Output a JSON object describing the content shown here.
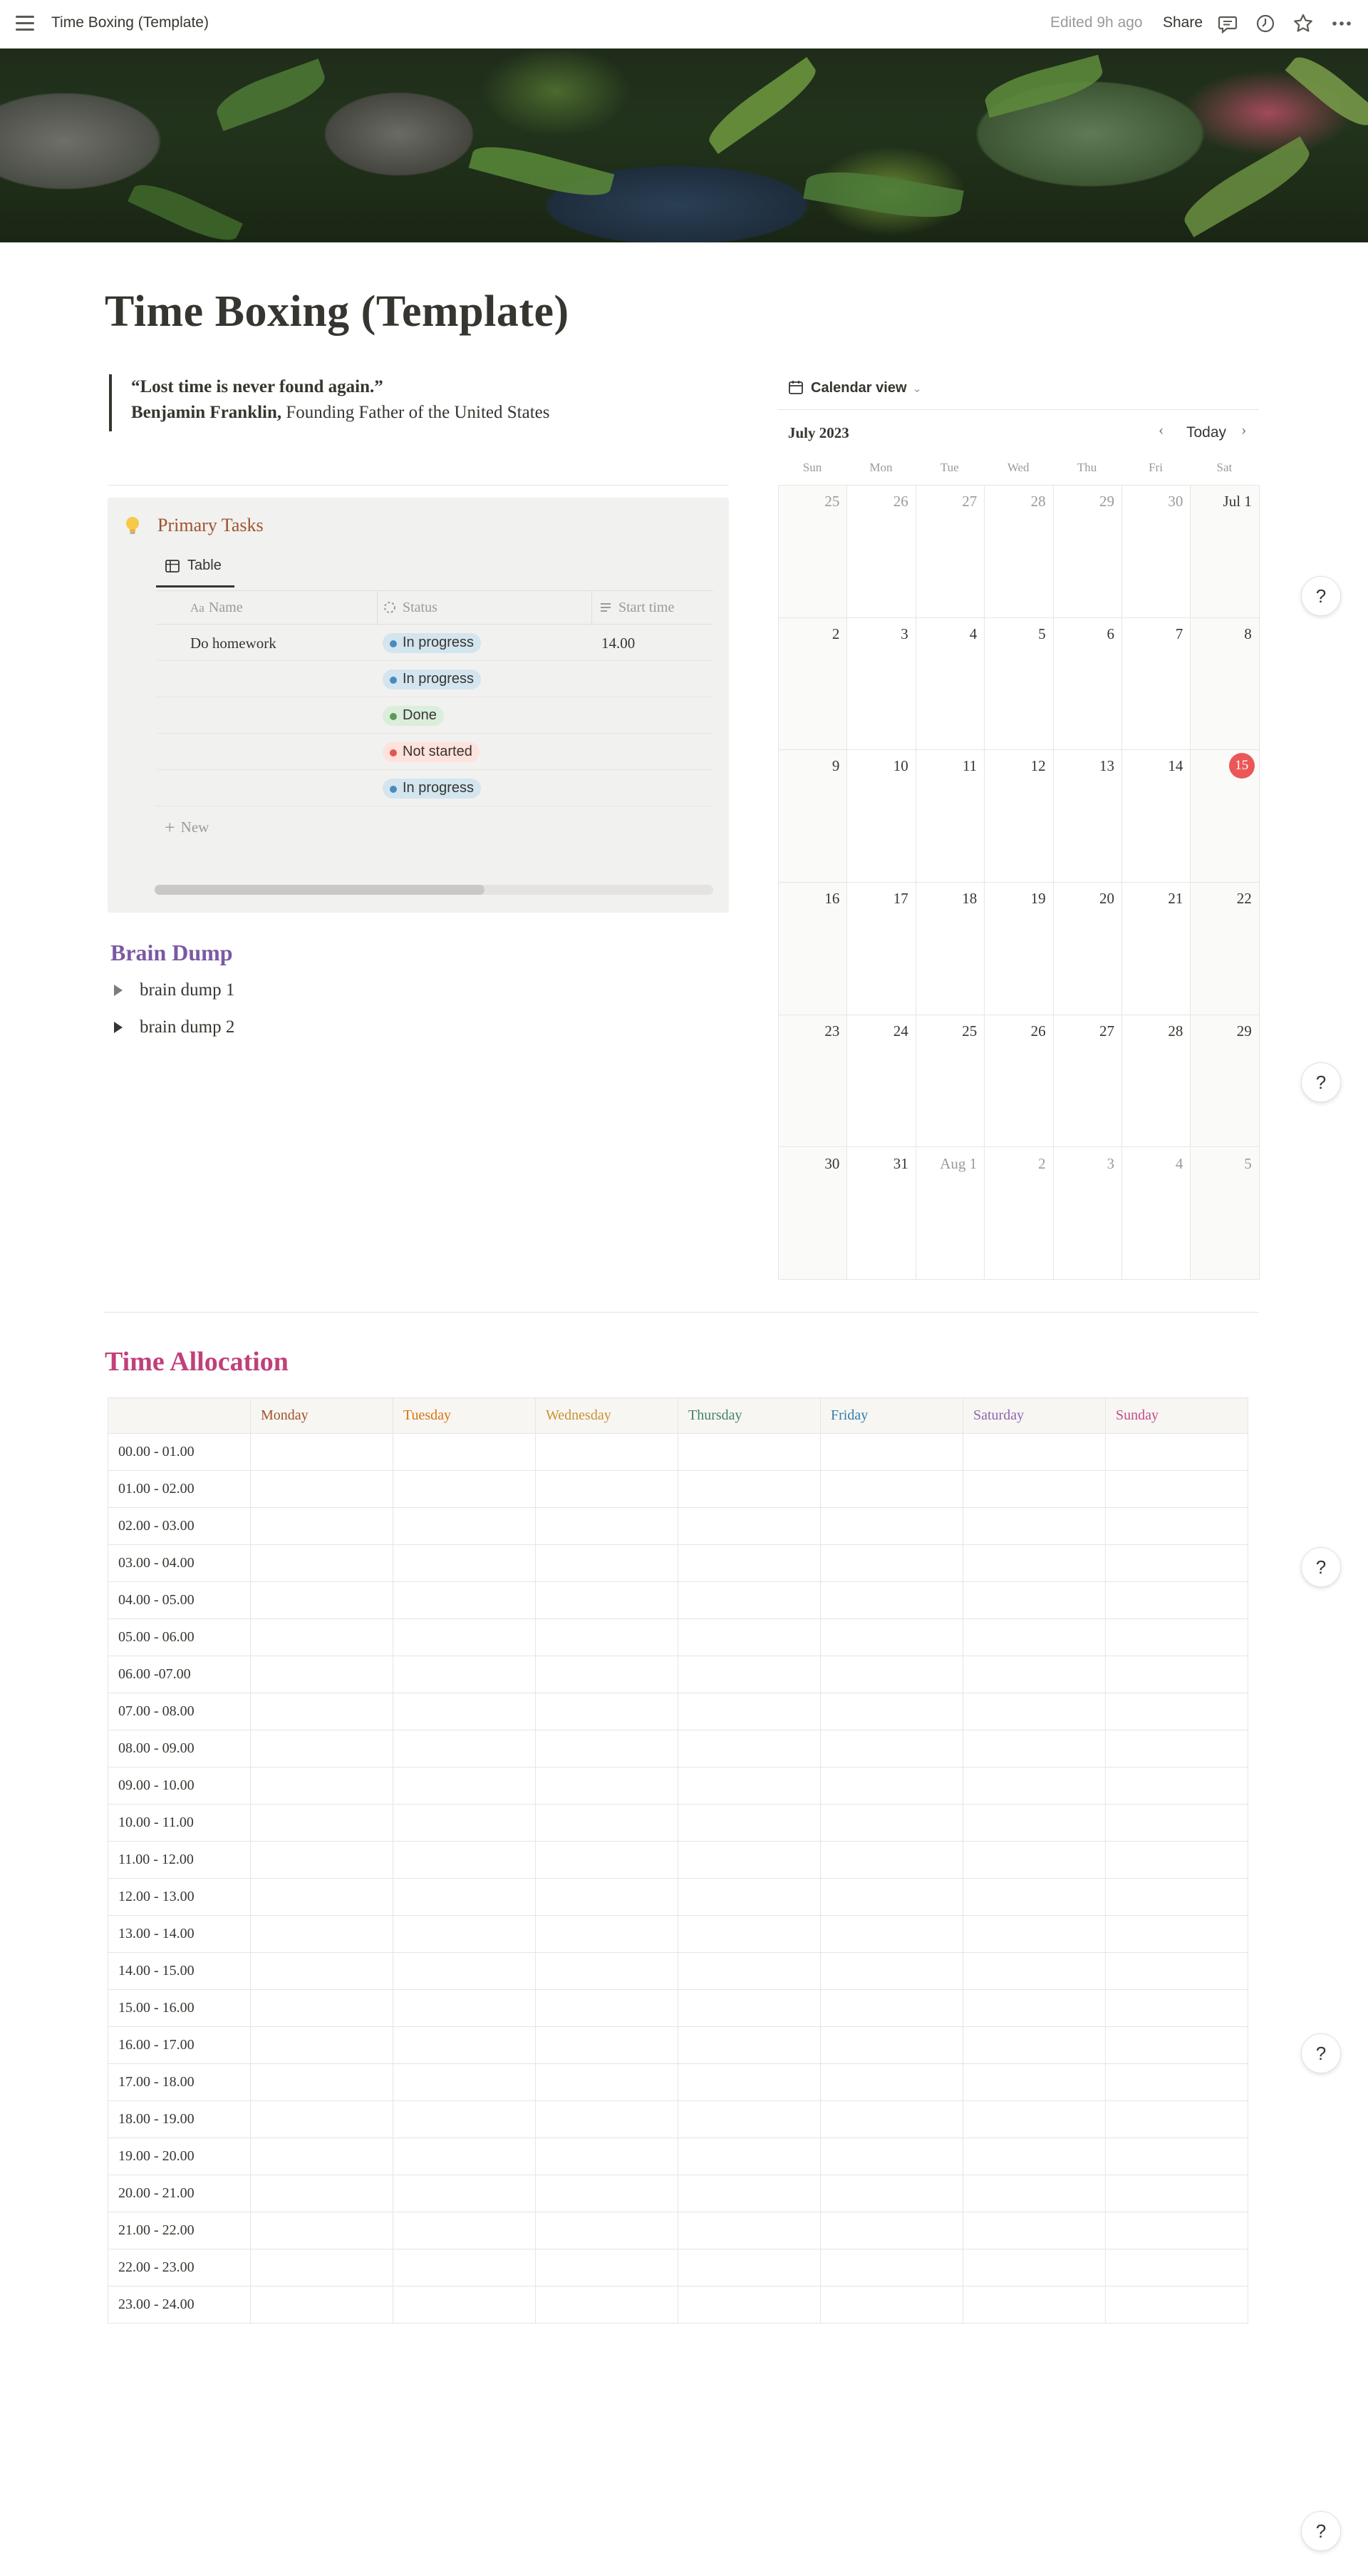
{
  "topbar": {
    "title": "Time Boxing (Template)",
    "edited": "Edited 9h ago",
    "share": "Share",
    "icons": [
      "menu-icon",
      "comment-icon",
      "history-icon",
      "star-icon",
      "more-icon"
    ]
  },
  "page": {
    "title": "Time Boxing (Template)"
  },
  "quote": {
    "line1": "“Lost time is never found again.”",
    "author": "Benjamin Franklin,",
    "author_desc": " Founding Father of the United States"
  },
  "primary_tasks": {
    "icon": "lightbulb-icon",
    "title": "Primary Tasks",
    "view_tab": "Table",
    "columns": [
      "Name",
      "Status",
      "Start time"
    ],
    "rows": [
      {
        "name": "Do homework",
        "status": "In progress",
        "start": "14.00"
      },
      {
        "name": "",
        "status": "In progress",
        "start": ""
      },
      {
        "name": "",
        "status": "Done",
        "start": ""
      },
      {
        "name": "",
        "status": "Not started",
        "start": ""
      },
      {
        "name": "",
        "status": "In progress",
        "start": ""
      }
    ],
    "new_label": "New",
    "status_colors": {
      "In progress": {
        "bg": "#d3e5ef",
        "dot": "#4a8bbd"
      },
      "Done": {
        "bg": "#dbeddb",
        "dot": "#5c9a5c"
      },
      "Not started": {
        "bg": "#ffe2dd",
        "dot": "#e0574f"
      }
    },
    "scroll_fraction": 0.59
  },
  "brain_dump": {
    "title": "Brain Dump",
    "items": [
      "brain dump 1",
      "brain dump 2"
    ]
  },
  "calendar": {
    "view_label": "Calendar view",
    "month": "July 2023",
    "today_label": "Today",
    "weekdays": [
      "Sun",
      "Mon",
      "Tue",
      "Wed",
      "Thu",
      "Fri",
      "Sat"
    ],
    "weeks": [
      [
        "25",
        "26",
        "27",
        "28",
        "29",
        "30",
        "Jul 1"
      ],
      [
        "2",
        "3",
        "4",
        "5",
        "6",
        "7",
        "8"
      ],
      [
        "9",
        "10",
        "11",
        "12",
        "13",
        "14",
        "15"
      ],
      [
        "16",
        "17",
        "18",
        "19",
        "20",
        "21",
        "22"
      ],
      [
        "23",
        "24",
        "25",
        "26",
        "27",
        "28",
        "29"
      ],
      [
        "30",
        "31",
        "Aug 1",
        "2",
        "3",
        "4",
        "5"
      ]
    ],
    "today": "15",
    "today_color": "#eb5757"
  },
  "time_allocation": {
    "title": "Time Allocation",
    "days": [
      {
        "label": "Monday",
        "color": "#a0522d"
      },
      {
        "label": "Tuesday",
        "color": "#d9730d"
      },
      {
        "label": "Wednesday",
        "color": "#cb912f"
      },
      {
        "label": "Thursday",
        "color": "#448361"
      },
      {
        "label": "Friday",
        "color": "#337ea9"
      },
      {
        "label": "Saturday",
        "color": "#9065b0"
      },
      {
        "label": "Sunday",
        "color": "#c14c8a"
      }
    ],
    "slots": [
      "00.00 - 01.00",
      "01.00 - 02.00",
      "02.00 - 03.00",
      "03.00 - 04.00",
      "04.00 - 05.00",
      "05.00 - 06.00",
      "06.00 -07.00",
      "07.00 - 08.00",
      "08.00 - 09.00",
      "09.00 - 10.00",
      "10.00 - 11.00",
      "11.00 - 12.00",
      "12.00 - 13.00",
      "13.00 - 14.00",
      "14.00 - 15.00",
      "15.00 - 16.00",
      "16.00 - 17.00",
      "17.00 - 18.00",
      "18.00 - 19.00",
      "19.00 - 20.00",
      "20.00 - 21.00",
      "21.00 - 22.00",
      "22.00 - 23.00",
      "23.00 - 24.00"
    ]
  },
  "help_label": "?"
}
